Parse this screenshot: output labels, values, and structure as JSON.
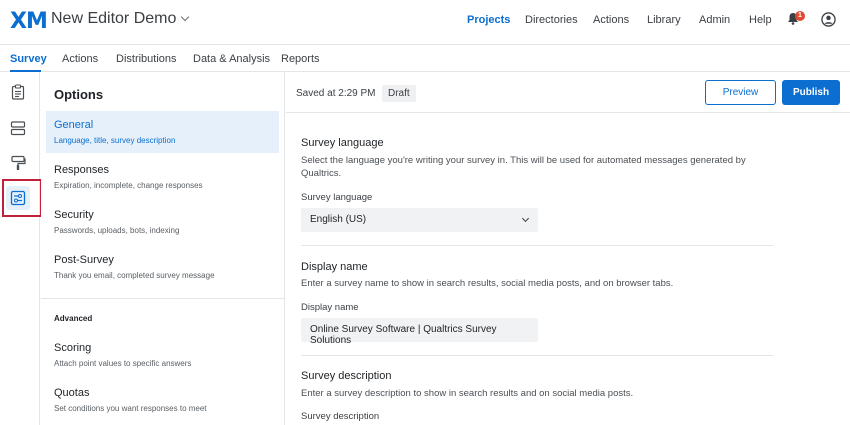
{
  "header": {
    "logo": "XM",
    "project_title": "New Editor Demo",
    "nav": [
      "Projects",
      "Directories",
      "Actions",
      "Library",
      "Admin",
      "Help"
    ],
    "notification_count": "1"
  },
  "tabs": [
    "Survey",
    "Actions",
    "Distributions",
    "Data & Analysis",
    "Reports"
  ],
  "options": {
    "title": "Options",
    "items": [
      {
        "title": "General",
        "sub": "Language, title, survey description"
      },
      {
        "title": "Responses",
        "sub": "Expiration, incomplete, change responses"
      },
      {
        "title": "Security",
        "sub": "Passwords, uploads, bots, indexing"
      },
      {
        "title": "Post-Survey",
        "sub": "Thank you email, completed survey message"
      }
    ],
    "advanced_label": "Advanced",
    "advanced_items": [
      {
        "title": "Scoring",
        "sub": "Attach point values to specific answers"
      },
      {
        "title": "Quotas",
        "sub": "Set conditions you want responses to meet"
      }
    ]
  },
  "status": {
    "saved": "Saved at 2:29 PM",
    "draft": "Draft",
    "preview": "Preview",
    "publish": "Publish"
  },
  "sections": {
    "language": {
      "title": "Survey language",
      "desc": "Select the language you're writing your survey in. This will be used for automated messages generated by Qualtrics.",
      "label": "Survey language",
      "value": "English (US)"
    },
    "display_name": {
      "title": "Display name",
      "desc": "Enter a survey name to show in search results, social media posts, and on browser tabs.",
      "label": "Display name",
      "value": "Online Survey Software | Qualtrics Survey Solutions"
    },
    "description": {
      "title": "Survey description",
      "desc": "Enter a survey description to show in search results and on social media posts.",
      "label": "Survey description"
    }
  },
  "colors": {
    "accent": "#0b6ed0",
    "highlight": "#c0203a",
    "badge": "#e04a2f"
  }
}
